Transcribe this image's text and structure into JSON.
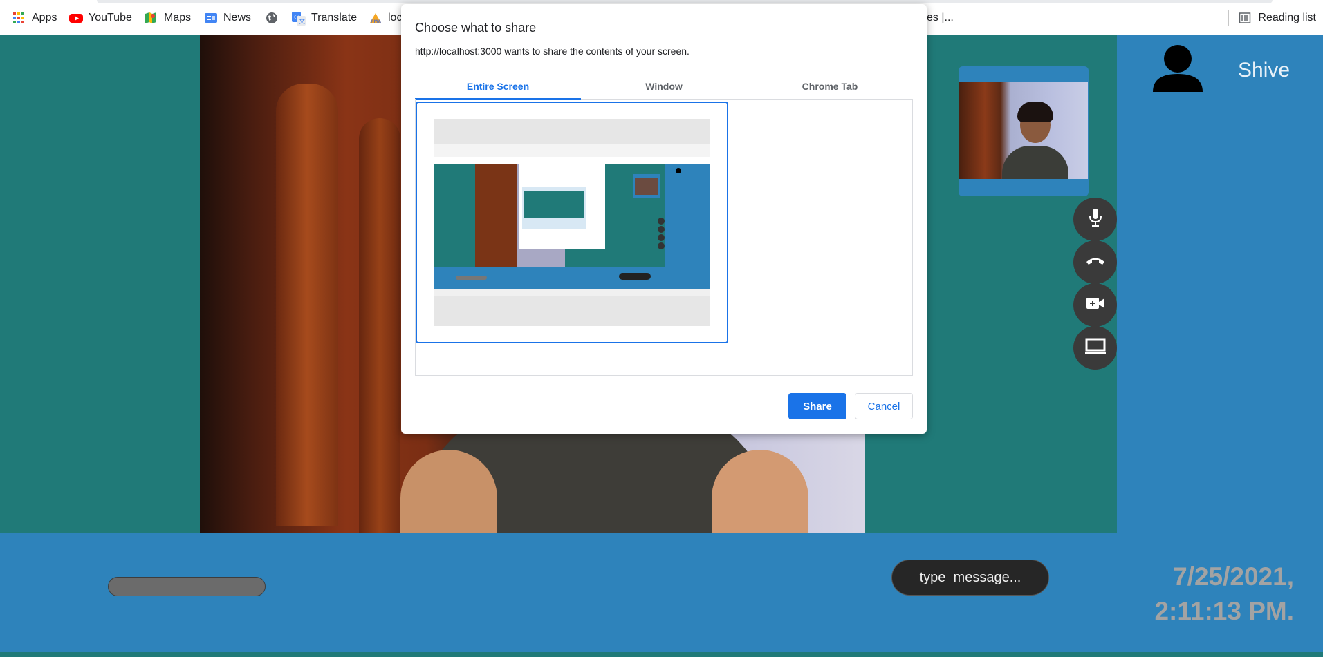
{
  "bookmarks": {
    "items": [
      {
        "label": "Apps",
        "icon": "apps-grid-icon"
      },
      {
        "label": "YouTube",
        "icon": "youtube-icon"
      },
      {
        "label": "Maps",
        "icon": "maps-icon"
      },
      {
        "label": "News",
        "icon": "news-icon"
      },
      {
        "label": "",
        "icon": "globe-icon"
      },
      {
        "label": "Translate",
        "icon": "translate-icon"
      },
      {
        "label": "loc",
        "icon": "pma-icon"
      },
      {
        "label": "es |...",
        "icon": ""
      }
    ],
    "reading_list": "Reading list"
  },
  "dialog": {
    "title": "Choose what to share",
    "subtitle": "http://localhost:3000 wants to share the contents of your screen.",
    "tabs": [
      "Entire Screen",
      "Window",
      "Chrome Tab"
    ],
    "active_tab": "Entire Screen",
    "share_label": "Share",
    "cancel_label": "Cancel"
  },
  "call": {
    "username": "Shive",
    "message_placeholder": "type  message...",
    "date": "7/25/2021,",
    "time": "2:11:13 PM.",
    "controls": [
      "microphone-icon",
      "hang-up-icon",
      "video-camera-icon",
      "screen-share-icon"
    ]
  },
  "colors": {
    "teal": "#207a78",
    "blue": "#2e83bb",
    "control_bg": "#3a3a3a",
    "accent": "#1a73e8"
  }
}
